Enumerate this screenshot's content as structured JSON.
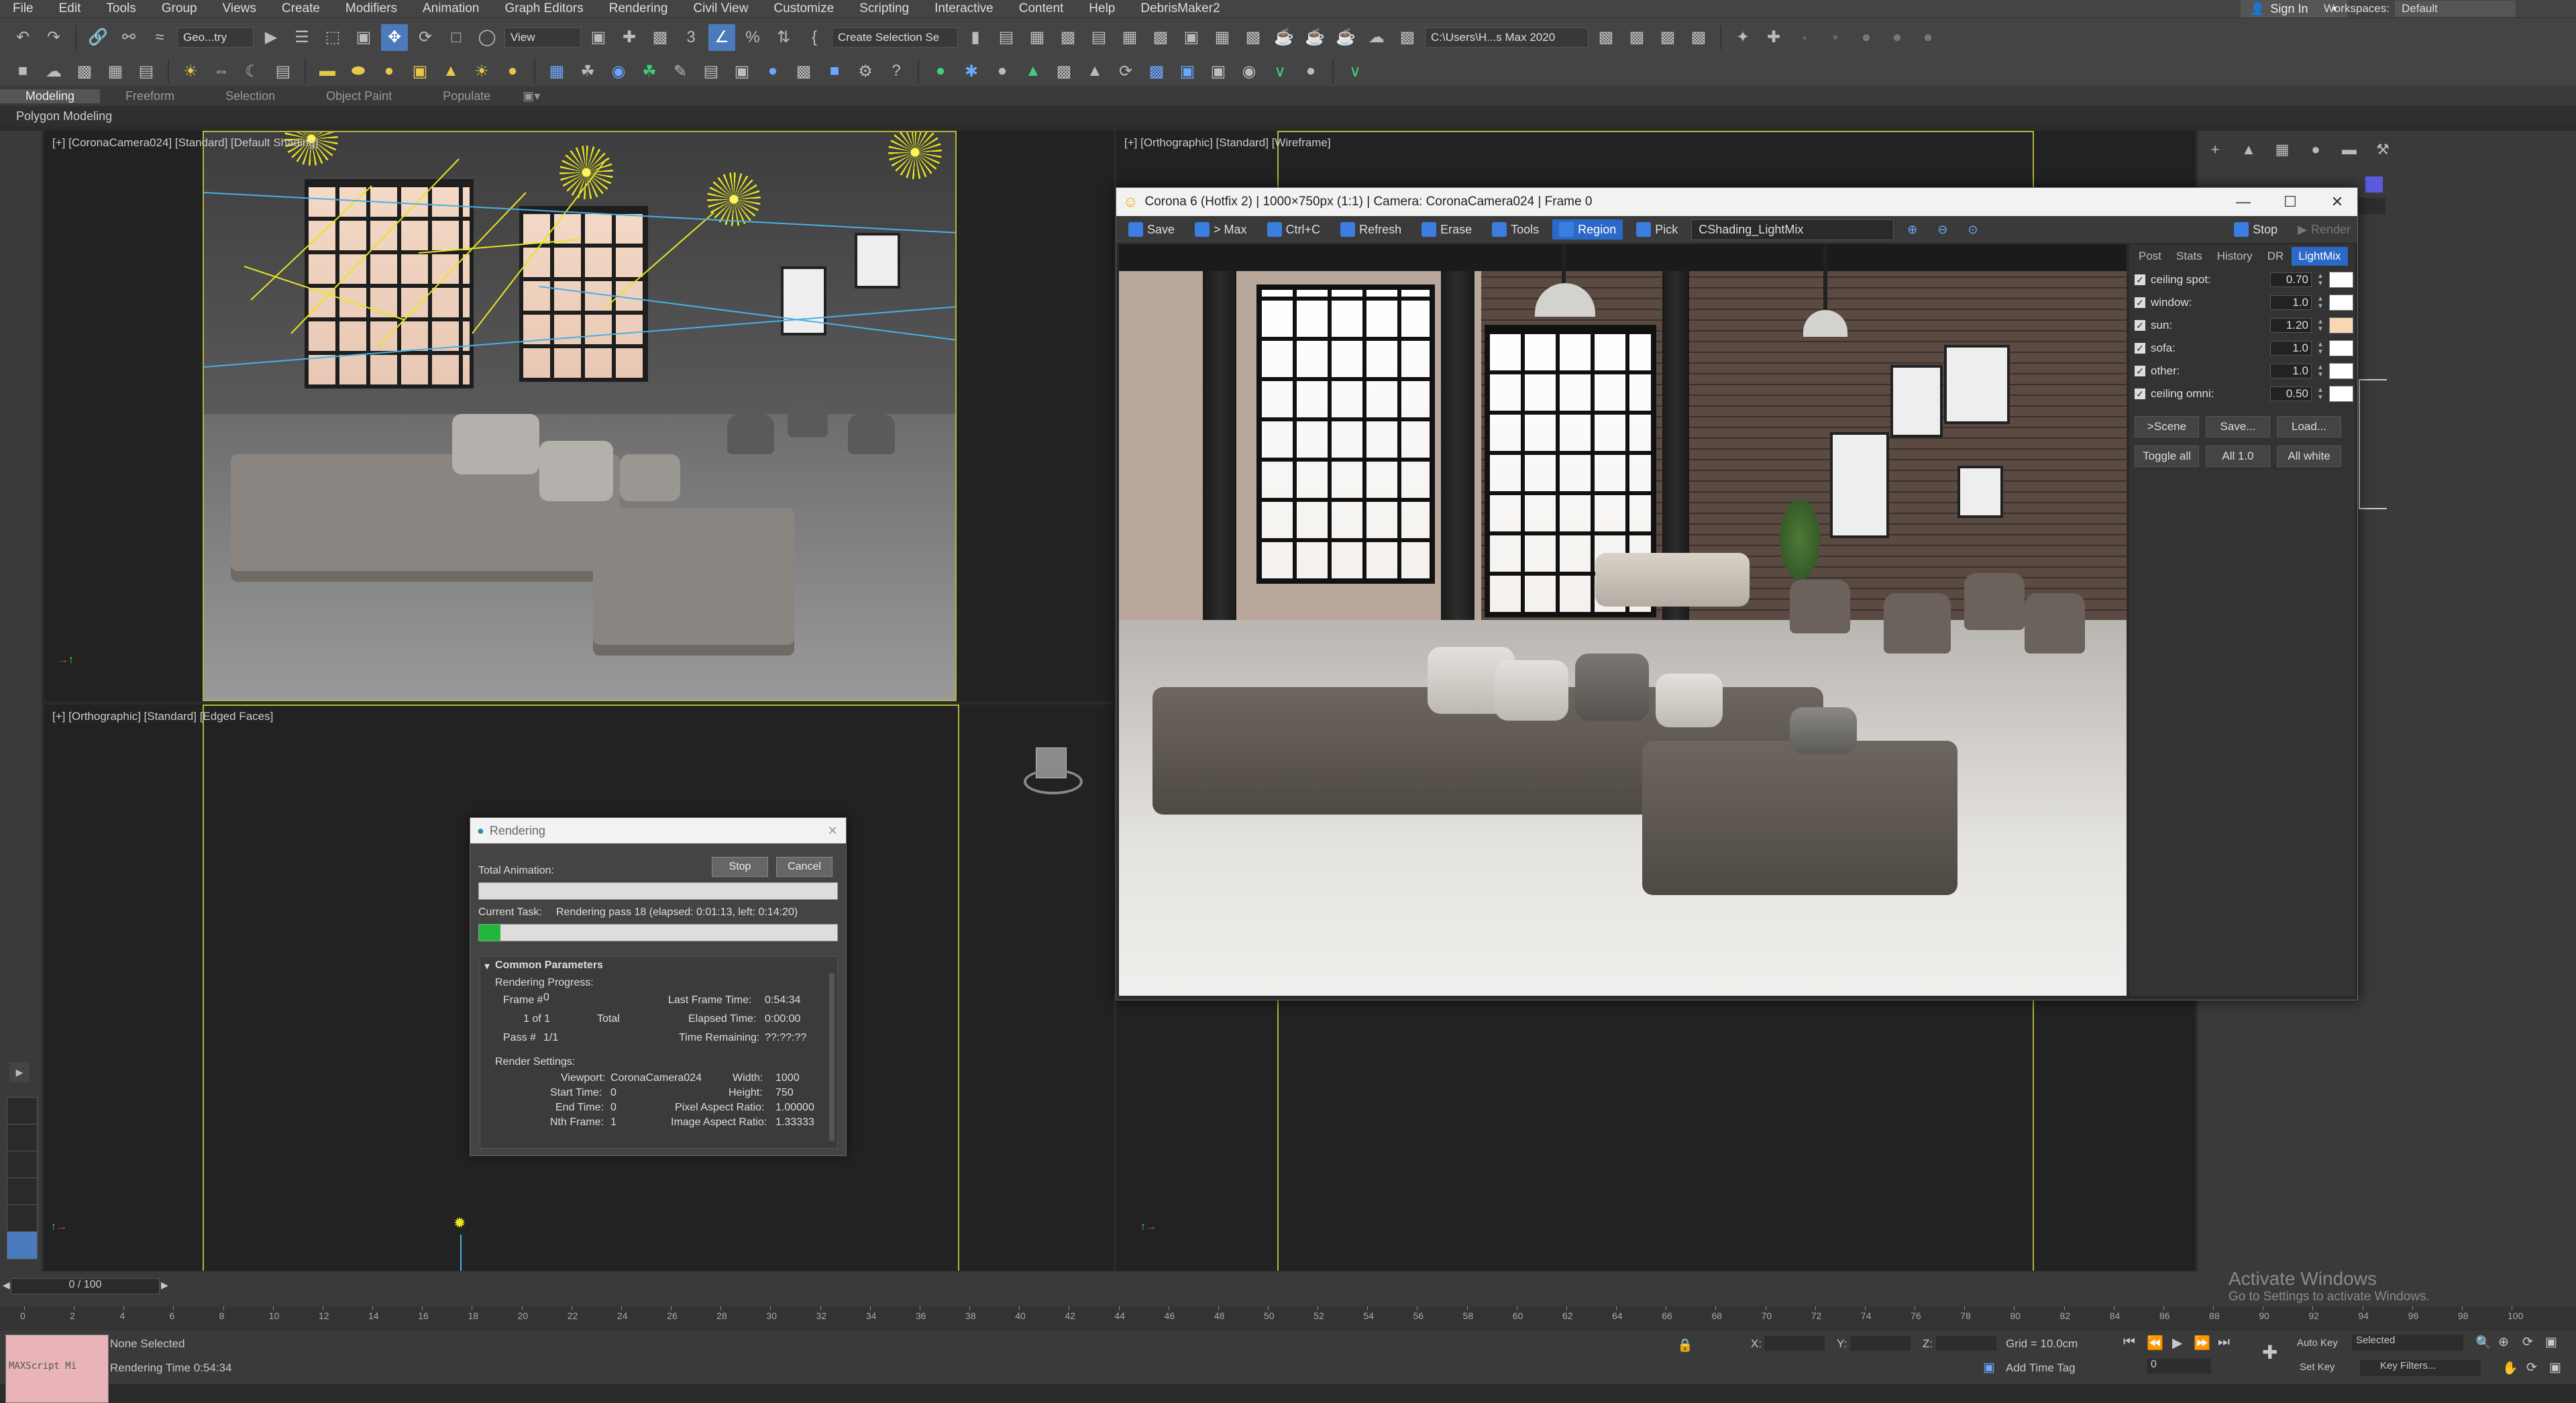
{
  "menu": [
    "File",
    "Edit",
    "Tools",
    "Group",
    "Views",
    "Create",
    "Modifiers",
    "Animation",
    "Graph Editors",
    "Rendering",
    "Civil View",
    "Customize",
    "Scripting",
    "Interactive",
    "Content",
    "Help",
    "DebrisMaker2"
  ],
  "signin": "Sign In",
  "workspaces": {
    "label": "Workspaces:",
    "value": "Default"
  },
  "toolbar": {
    "selection_filter": "Geo...try",
    "ref_coord": "View",
    "named_selection": "Create Selection Se",
    "project_path": "C:\\Users\\H...s Max 2020"
  },
  "ribbon_tabs": [
    "Modeling",
    "Freeform",
    "Selection",
    "Object Paint",
    "Populate"
  ],
  "ribbon_active": "Modeling",
  "polygon_modeling": "Polygon Modeling",
  "viewports": {
    "top_left": "[+] [CoronaCamera024] [Standard] [Default Shading]",
    "top_right": "[+] [Orthographic] [Standard] [Wireframe]",
    "bottom_left": "[+] [Orthographic] [Standard] [Edged Faces]"
  },
  "vfb": {
    "title": "Corona 6 (Hotfix 2) | 1000×750px (1:1) | Camera: CoronaCamera024 | Frame 0",
    "buttons": [
      "Save",
      "> Max",
      "Ctrl+C",
      "Refresh",
      "Erase",
      "Tools",
      "Region",
      "Pick"
    ],
    "active_button": "Region",
    "pass": "CShading_LightMix",
    "stop": "Stop",
    "render": "Render",
    "tabs": [
      "Post",
      "Stats",
      "History",
      "DR",
      "LightMix"
    ],
    "active_tab": "LightMix",
    "lights": [
      {
        "name": "ceiling spot:",
        "value": "0.70",
        "color": "#ffffff"
      },
      {
        "name": "window:",
        "value": "1.0",
        "color": "#ffffff"
      },
      {
        "name": "sun:",
        "value": "1.20",
        "color": "#f7d7b4"
      },
      {
        "name": "sofa:",
        "value": "1.0",
        "color": "#ffffff"
      },
      {
        "name": "other:",
        "value": "1.0",
        "color": "#ffffff"
      },
      {
        "name": "ceiling omni:",
        "value": "0.50",
        "color": "#ffffff"
      }
    ],
    "lm_buttons_row1": [
      ">Scene",
      "Save...",
      "Load..."
    ],
    "lm_buttons_row2": [
      "Toggle all",
      "All 1.0",
      "All white"
    ]
  },
  "render_dialog": {
    "title": "Rendering",
    "total_animation": "Total Animation:",
    "stop": "Stop",
    "cancel": "Cancel",
    "current_task_label": "Current Task:",
    "current_task": "Rendering pass 18 (elapsed: 0:01:13, left: 0:14:20)",
    "task_progress": 0.06,
    "common_params": "Common Parameters",
    "rendering_progress": "Rendering Progress:",
    "frame_label": "Frame #",
    "frame_value": "0",
    "last_frame_label": "Last Frame Time:",
    "last_frame_value": "0:54:34",
    "of_label": "1 of 1",
    "total": "Total",
    "elapsed_label": "Elapsed Time:",
    "elapsed_value": "0:00:00",
    "pass_label": "Pass #",
    "pass_value": "1/1",
    "remaining_label": "Time Remaining:",
    "remaining_value": "??:??:??",
    "render_settings": "Render Settings:",
    "viewport_label": "Viewport:",
    "viewport_value": "CoronaCamera024",
    "width_label": "Width:",
    "width_value": "1000",
    "start_label": "Start Time:",
    "start_value": "0",
    "height_label": "Height:",
    "height_value": "750",
    "end_label": "End Time:",
    "end_value": "0",
    "par_label": "Pixel Aspect Ratio:",
    "par_value": "1.00000",
    "nth_label": "Nth Frame:",
    "nth_value": "1",
    "iar_label": "Image Aspect Ratio:",
    "iar_value": "1.33333"
  },
  "timeline": {
    "thumb": "0 / 100",
    "ticks": [
      "0",
      "2",
      "4",
      "6",
      "8",
      "10",
      "12",
      "14",
      "16",
      "18",
      "20",
      "22",
      "24",
      "26",
      "28",
      "30",
      "32",
      "34",
      "36",
      "38",
      "40",
      "42",
      "44",
      "46",
      "48",
      "50",
      "52",
      "54",
      "56",
      "58",
      "60",
      "62",
      "64",
      "66",
      "68",
      "70",
      "72",
      "74",
      "76",
      "78",
      "80",
      "82",
      "84",
      "86",
      "88",
      "90",
      "92",
      "94",
      "96",
      "98",
      "100"
    ]
  },
  "status": {
    "maxscript": "MAXScript Mi",
    "selection": "None Selected",
    "render_time": "Rendering Time  0:54:34",
    "x_label": "X:",
    "y_label": "Y:",
    "z_label": "Z:",
    "grid": "Grid = 10.0cm",
    "add_time_tag": "Add Time Tag",
    "auto_key": "Auto Key",
    "selected": "Selected",
    "set_key": "Set Key",
    "key_filters": "Key Filters...",
    "frame": "0"
  },
  "activate": {
    "title": "Activate Windows",
    "subtitle": "Go to Settings to activate Windows."
  }
}
